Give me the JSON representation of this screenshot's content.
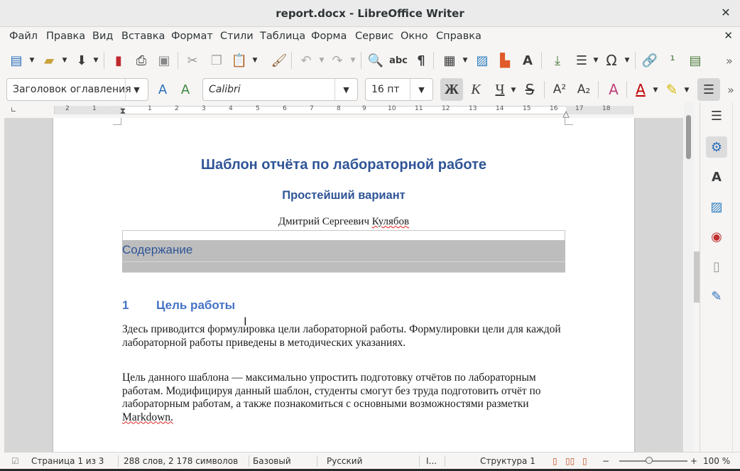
{
  "window": {
    "title": "report.docx - LibreOffice Writer",
    "close_glyph": "✕"
  },
  "menu": {
    "items": [
      {
        "label": "Файл"
      },
      {
        "label": "Правка"
      },
      {
        "label": "Вид"
      },
      {
        "label": "Вставка"
      },
      {
        "label": "Формат"
      },
      {
        "label": "Стили"
      },
      {
        "label": "Таблица"
      },
      {
        "label": "Форма"
      },
      {
        "label": "Сервис"
      },
      {
        "label": "Окно"
      },
      {
        "label": "Справка"
      }
    ],
    "close_document_glyph": "✕"
  },
  "formatting": {
    "paragraph_style": "Заголовок оглавления",
    "font_name": "Calibri",
    "font_size": "16 пт",
    "bold_label": "Ж",
    "italic_label": "К",
    "underline_label": "Ч",
    "strike_label": "S",
    "superscript_label": "A²",
    "subscript_label": "A₂"
  },
  "ruler": {
    "labels": [
      "2",
      "1",
      "1",
      "2",
      "3",
      "4",
      "5",
      "6",
      "7",
      "8",
      "9",
      "10",
      "11",
      "12",
      "13",
      "14",
      "15",
      "16",
      "17",
      "18"
    ]
  },
  "document": {
    "title": "Шаблон отчёта по лабораторной работе",
    "subtitle": "Простейший вариант",
    "author_first": "Дмитрий Сергеевич ",
    "author_last": "Кулябов",
    "toc_heading": "Содержание",
    "section_number": "1",
    "section_title": "Цель работы",
    "paragraph1": "Здесь приводится формулировка цели лабораторной работы. Формулировки цели для каждой лабораторной работы приведены в методических указаниях.",
    "paragraph2_text": "Цель данного шаблона — максимально упростить подготовку отчётов по лабораторным работам. Модифицируя данный шаблон, студенты смогут без труда подготовить отчёт по лабораторным работам, а также познакомиться с основными возможностями разметки  ",
    "paragraph2_last": "Markdown."
  },
  "statusbar": {
    "page": "Страница 1 из 3",
    "words": "288 слов, 2 178 символов",
    "page_style": "Базовый",
    "language": "Русский",
    "insert_mode": "I...",
    "outline": "Структура 1",
    "zoom": "100 %"
  }
}
